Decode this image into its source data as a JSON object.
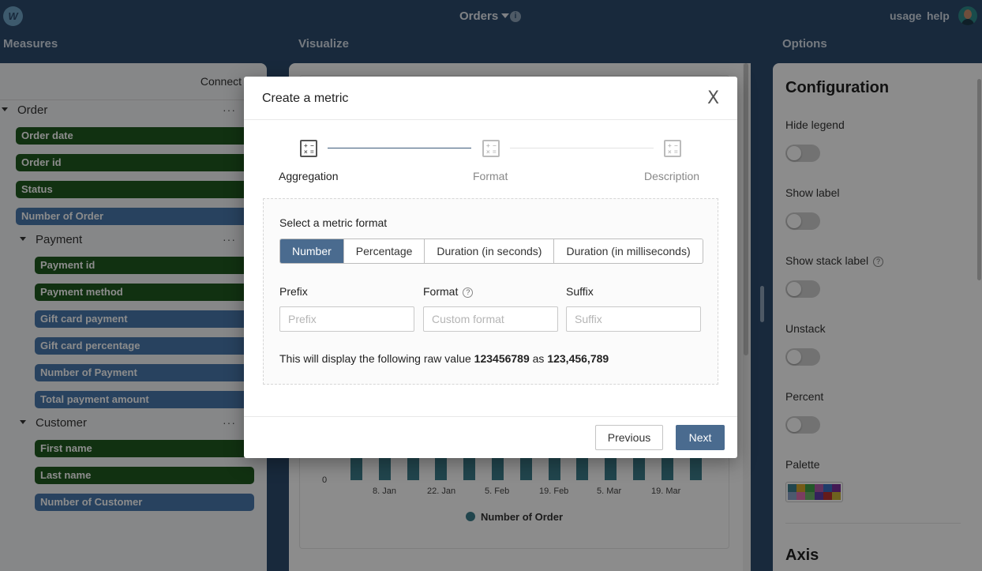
{
  "topbar": {
    "logo": "W",
    "title": "Orders",
    "info": "i",
    "links": [
      "usage",
      "help"
    ]
  },
  "sections": {
    "measures": "Measures",
    "visualize": "Visualize",
    "options": "Options"
  },
  "measures": {
    "connect": "Connect",
    "dots": "···",
    "groups": {
      "order": "Order",
      "payment": "Payment",
      "customer": "Customer"
    },
    "items": [
      {
        "label": "Order date",
        "kind": "dimension"
      },
      {
        "label": "Order id",
        "kind": "dimension"
      },
      {
        "label": "Status",
        "kind": "dimension"
      },
      {
        "label": "Number of Order",
        "kind": "metric"
      },
      {
        "label": "Payment id",
        "kind": "dimension"
      },
      {
        "label": "Payment method",
        "kind": "dimension"
      },
      {
        "label": "Gift card payment",
        "kind": "metric"
      },
      {
        "label": "Gift card percentage",
        "kind": "metric"
      },
      {
        "label": "Number of Payment",
        "kind": "metric"
      },
      {
        "label": "Total payment amount",
        "kind": "metric"
      },
      {
        "label": "First name",
        "kind": "dimension"
      },
      {
        "label": "Last name",
        "kind": "dimension"
      },
      {
        "label": "Number of Customer",
        "kind": "metric"
      }
    ]
  },
  "chart": {
    "y_tick": "0",
    "x_ticks": [
      "8. Jan",
      "22. Jan",
      "5. Feb",
      "19. Feb",
      "5. Mar",
      "19. Mar"
    ],
    "legend": "Number of Order"
  },
  "options": {
    "title": "Configuration",
    "toggles": [
      {
        "label": "Hide legend",
        "on": false
      },
      {
        "label": "Show label",
        "on": false
      },
      {
        "label": "Show stack label",
        "on": false
      },
      {
        "label": "Unstack",
        "on": false
      },
      {
        "label": "Percent",
        "on": false
      }
    ],
    "help_icon": "?",
    "palette_label": "Palette",
    "palette_colors": [
      "#3d7f8c",
      "#d4a62a",
      "#3e9e4a",
      "#b05aa8",
      "#3a6ec2",
      "#7b2f9a",
      "#8aa3c8",
      "#e06fb0",
      "#6db56a",
      "#5d3fa8",
      "#b83232",
      "#c9b33a"
    ],
    "axis_title": "Axis"
  },
  "modal": {
    "title": "Create a metric",
    "close": "X",
    "steps": [
      {
        "label": "Aggregation",
        "active": true
      },
      {
        "label": "Format",
        "active": false
      },
      {
        "label": "Description",
        "active": false
      }
    ],
    "format_heading": "Select a metric format",
    "format_options": [
      "Number",
      "Percentage",
      "Duration (in seconds)",
      "Duration (in milliseconds)"
    ],
    "selected_format": "Number",
    "prefix_label": "Prefix",
    "prefix_placeholder": "Prefix",
    "prefix_value": "",
    "format_label": "Format",
    "format_placeholder": "Custom format",
    "format_value": "",
    "suffix_label": "Suffix",
    "suffix_placeholder": "Suffix",
    "suffix_value": "",
    "preview_prefix": "This will display the following raw value",
    "raw_value": "123456789",
    "preview_as": "as",
    "formatted_value": "123,456,789",
    "prev_button": "Previous",
    "next_button": "Next"
  }
}
